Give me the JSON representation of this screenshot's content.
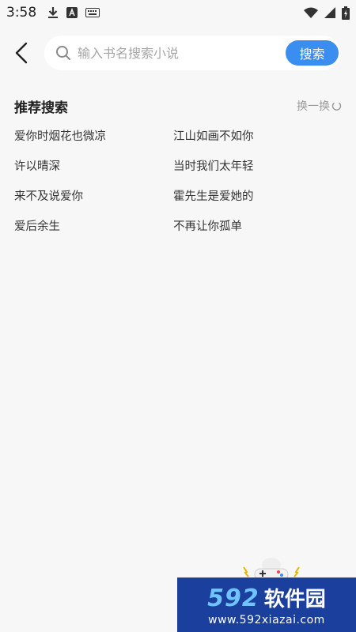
{
  "status_bar": {
    "time": "3:58",
    "left_icons": [
      "download-icon",
      "a-badge-icon",
      "keyboard-icon"
    ],
    "right_icons": [
      "wifi-icon",
      "signal-icon",
      "battery-icon"
    ]
  },
  "header": {
    "back_icon": "back-chevron-icon",
    "search_placeholder": "输入书名搜索小说",
    "search_value": "",
    "search_button": "搜索",
    "accent_color": "#3a8ef0"
  },
  "recommend": {
    "title": "推荐搜索",
    "refresh_label": "换一换",
    "keywords": [
      "爱你时烟花也微凉",
      "江山如画不如你",
      "许以晴深",
      "当时我们太年轻",
      "来不及说爱你",
      "霍先生是爱她的",
      "爱后余生",
      "不再让你孤单"
    ]
  },
  "watermark": {
    "logo_number": "592",
    "logo_text": "软件园",
    "url": "www.592xiazai.com",
    "background": "#1a3f9c"
  }
}
